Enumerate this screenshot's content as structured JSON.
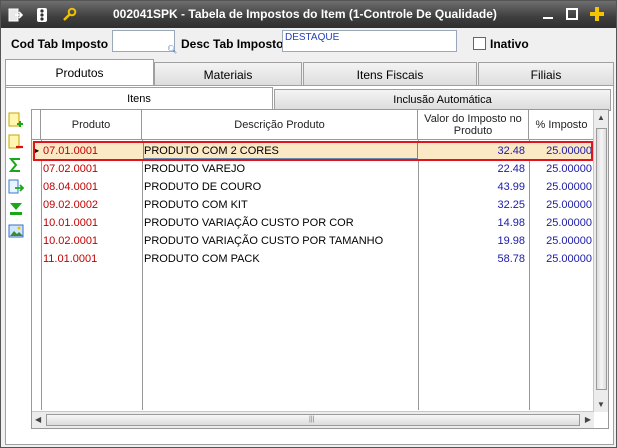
{
  "window": {
    "title": "002041SPK - Tabela de Impostos do Item (1-Controle De Qualidade)"
  },
  "header": {
    "cod_label": "Cod Tab Imposto",
    "cod_value": "",
    "desc_label": "Desc Tab Imposto",
    "desc_value": "DESTAQUE",
    "inativo_label": "Inativo",
    "inativo_checked": false
  },
  "tabs": [
    "Produtos",
    "Materiais",
    "Itens Fiscais",
    "Filiais"
  ],
  "subtabs": [
    "Itens",
    "Inclusão Automática"
  ],
  "grid": {
    "columns": [
      "Produto",
      "Descrição Produto",
      "Valor do Imposto no Produto",
      "% Imposto"
    ],
    "rows": [
      {
        "produto": "07.01.0001",
        "descricao": "PRODUTO COM 2 CORES",
        "valor": "32.48",
        "pct": "25.00000"
      },
      {
        "produto": "07.02.0001",
        "descricao": "PRODUTO VAREJO",
        "valor": "22.48",
        "pct": "25.00000"
      },
      {
        "produto": "08.04.0001",
        "descricao": "PRODUTO DE COURO",
        "valor": "43.99",
        "pct": "25.00000"
      },
      {
        "produto": "09.02.0002",
        "descricao": "PRODUTO COM KIT",
        "valor": "32.25",
        "pct": "25.00000"
      },
      {
        "produto": "10.01.0001",
        "descricao": "PRODUTO VARIAÇÃO CUSTO POR COR",
        "valor": "14.98",
        "pct": "25.00000"
      },
      {
        "produto": "10.02.0001",
        "descricao": "PRODUTO VARIAÇÃO CUSTO POR TAMANHO",
        "valor": "19.98",
        "pct": "25.00000"
      },
      {
        "produto": "11.01.0001",
        "descricao": "PRODUTO COM PACK",
        "valor": "58.78",
        "pct": "25.00000"
      }
    ]
  },
  "colors": {
    "selection_border": "#e0141e",
    "selection_fill": "#fbe9c6",
    "product_code": "#c00000",
    "numbers": "#1a1aa8"
  },
  "icons": {
    "titlebar": [
      "exit-icon",
      "toolbar-icon",
      "tools-icon"
    ],
    "window_controls": [
      "minimize-icon",
      "maximize-icon",
      "add-icon"
    ],
    "side_toolbar": [
      "add-row-icon",
      "delete-row-icon",
      "sum-icon",
      "export-icon",
      "filter-icon",
      "image-icon"
    ]
  }
}
